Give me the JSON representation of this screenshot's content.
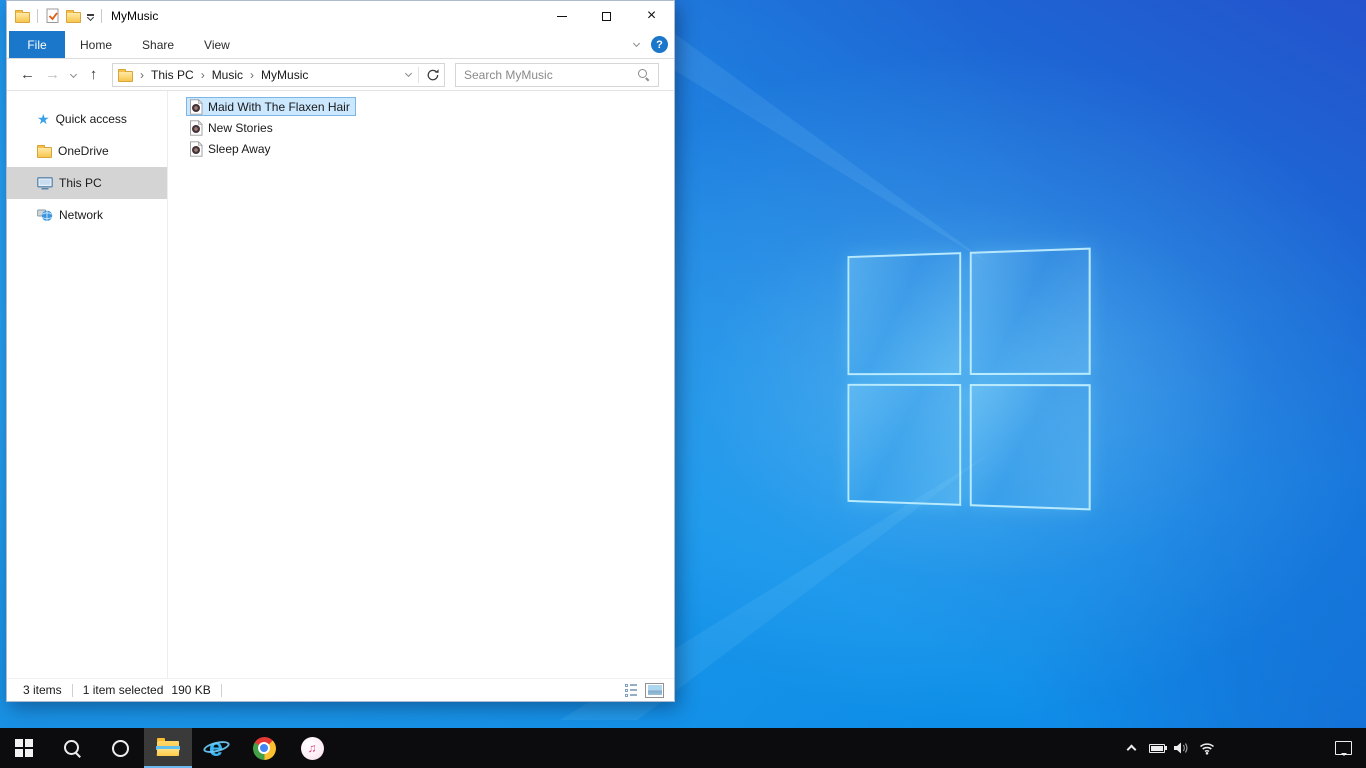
{
  "titlebar": {
    "title": "MyMusic",
    "close_glyph": "×"
  },
  "ribbon": {
    "file_tab": "File",
    "tabs": [
      {
        "label": "Home"
      },
      {
        "label": "Share"
      },
      {
        "label": "View"
      }
    ],
    "help_glyph": "?"
  },
  "addressbar": {
    "back_glyph": "←",
    "forward_glyph": "→",
    "up_glyph": "↑",
    "crumb_sep": "›",
    "breadcrumb": [
      "This PC",
      "Music",
      "MyMusic"
    ]
  },
  "search": {
    "placeholder": "Search MyMusic"
  },
  "nav": {
    "star_glyph": "★",
    "items": [
      {
        "label": "Quick access"
      },
      {
        "label": "OneDrive"
      },
      {
        "label": "This PC",
        "selected": true
      },
      {
        "label": "Network"
      }
    ]
  },
  "files": {
    "items": [
      {
        "name": "Maid With The Flaxen Hair",
        "selected": true
      },
      {
        "name": "New Stories"
      },
      {
        "name": "Sleep Away"
      }
    ]
  },
  "statusbar": {
    "items_count": "3 items",
    "selected_count": "1 item selected",
    "selected_size": "190 KB"
  },
  "taskbar": {
    "ie_glyph": "e",
    "itunes_note_glyph": "♫"
  },
  "colors": {
    "accent_blue": "#1a77c9",
    "selection_bg": "#cce8ff",
    "selection_border": "#7ab6e8",
    "nav_selected_bg": "#d4d4d4",
    "taskbar_bg": "#0c0c0e",
    "taskbar_active_underline": "#6cb8f0",
    "wallpaper_azure": "#0f8fe9",
    "wallpaper_royal": "#2453cd"
  }
}
